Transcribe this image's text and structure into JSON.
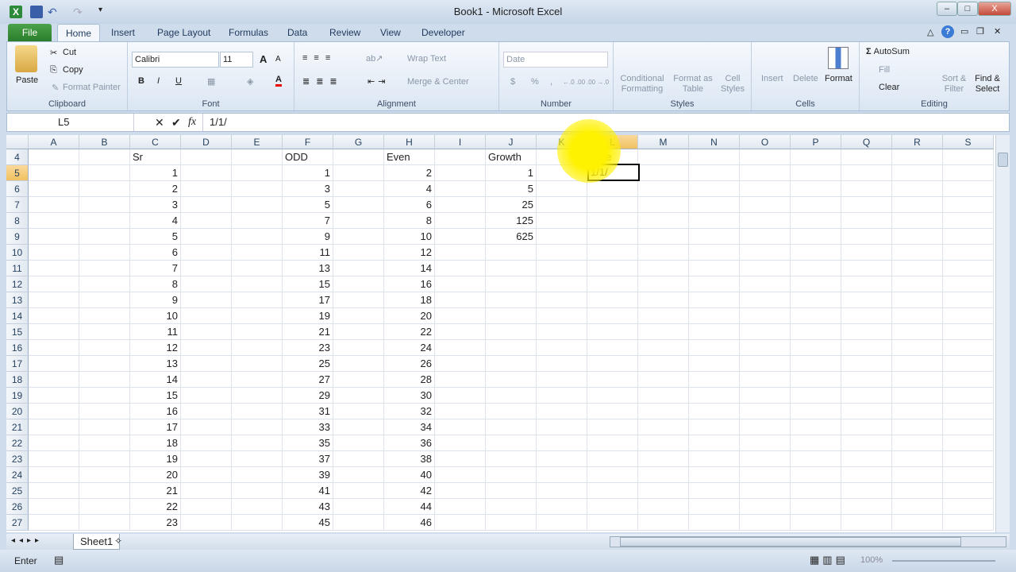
{
  "window": {
    "title": "Book1 - Microsoft Excel",
    "minimize": "–",
    "maximize": "□",
    "close": "X"
  },
  "tabs": [
    "File",
    "Home",
    "Insert",
    "Page Layout",
    "Formulas",
    "Data",
    "Review",
    "View",
    "Developer"
  ],
  "ribbon": {
    "clipboard": {
      "label": "Clipboard",
      "paste": "Paste",
      "cut": "Cut",
      "copy": "Copy",
      "format_painter": "Format Painter"
    },
    "font": {
      "label": "Font",
      "name": "Calibri",
      "size": "11",
      "bold": "B",
      "italic": "I",
      "underline": "U",
      "grow": "A",
      "shrink": "A",
      "color": "A"
    },
    "alignment": {
      "label": "Alignment",
      "wrap_text": "Wrap Text",
      "merge_center": "Merge & Center"
    },
    "number": {
      "label": "Number",
      "format": "Date",
      "currency": "$",
      "percent": "%",
      "comma": ",",
      "inc_dec": "←.0 .00",
      "dec_dec": ".00 →.0"
    },
    "styles": {
      "label": "Styles",
      "conditional": "Conditional Formatting",
      "format_table": "Format as Table",
      "cell_styles": "Cell Styles"
    },
    "cells": {
      "label": "Cells",
      "insert": "Insert",
      "delete": "Delete",
      "format": "Format"
    },
    "editing": {
      "label": "Editing",
      "autosum": "AutoSum",
      "fill": "Fill",
      "clear": "Clear",
      "sort": "Sort & Filter",
      "find": "Find & Select"
    }
  },
  "formula_bar": {
    "name_box": "L5",
    "cancel": "✕",
    "enter": "✔",
    "fx": "fx",
    "value": "1/1/"
  },
  "columns": [
    "A",
    "B",
    "C",
    "D",
    "E",
    "F",
    "G",
    "H",
    "I",
    "J",
    "K",
    "L",
    "M",
    "N",
    "O",
    "P",
    "Q",
    "R",
    "S"
  ],
  "rows": [
    {
      "n": "4",
      "C": "Sr",
      "F": "ODD",
      "H": "Even",
      "J": "Growth",
      "L": "Date"
    },
    {
      "n": "5",
      "C": "1",
      "F": "1",
      "H": "2",
      "J": "1"
    },
    {
      "n": "6",
      "C": "2",
      "F": "3",
      "H": "4",
      "J": "5"
    },
    {
      "n": "7",
      "C": "3",
      "F": "5",
      "H": "6",
      "J": "25"
    },
    {
      "n": "8",
      "C": "4",
      "F": "7",
      "H": "8",
      "J": "125"
    },
    {
      "n": "9",
      "C": "5",
      "F": "9",
      "H": "10",
      "J": "625"
    },
    {
      "n": "10",
      "C": "6",
      "F": "11",
      "H": "12"
    },
    {
      "n": "11",
      "C": "7",
      "F": "13",
      "H": "14"
    },
    {
      "n": "12",
      "C": "8",
      "F": "15",
      "H": "16"
    },
    {
      "n": "13",
      "C": "9",
      "F": "17",
      "H": "18"
    },
    {
      "n": "14",
      "C": "10",
      "F": "19",
      "H": "20"
    },
    {
      "n": "15",
      "C": "11",
      "F": "21",
      "H": "22"
    },
    {
      "n": "16",
      "C": "12",
      "F": "23",
      "H": "24"
    },
    {
      "n": "17",
      "C": "13",
      "F": "25",
      "H": "26"
    },
    {
      "n": "18",
      "C": "14",
      "F": "27",
      "H": "28"
    },
    {
      "n": "19",
      "C": "15",
      "F": "29",
      "H": "30"
    },
    {
      "n": "20",
      "C": "16",
      "F": "31",
      "H": "32"
    },
    {
      "n": "21",
      "C": "17",
      "F": "33",
      "H": "34"
    },
    {
      "n": "22",
      "C": "18",
      "F": "35",
      "H": "36"
    },
    {
      "n": "23",
      "C": "19",
      "F": "37",
      "H": "38"
    },
    {
      "n": "24",
      "C": "20",
      "F": "39",
      "H": "40"
    },
    {
      "n": "25",
      "C": "21",
      "F": "41",
      "H": "42"
    },
    {
      "n": "26",
      "C": "22",
      "F": "43",
      "H": "44"
    },
    {
      "n": "27",
      "C": "23",
      "F": "45",
      "H": "46"
    }
  ],
  "active_cell": {
    "ref": "L5",
    "value": "1/1/"
  },
  "sheets": [
    "Sheet1"
  ],
  "status": {
    "mode": "Enter",
    "zoom": "100%"
  }
}
